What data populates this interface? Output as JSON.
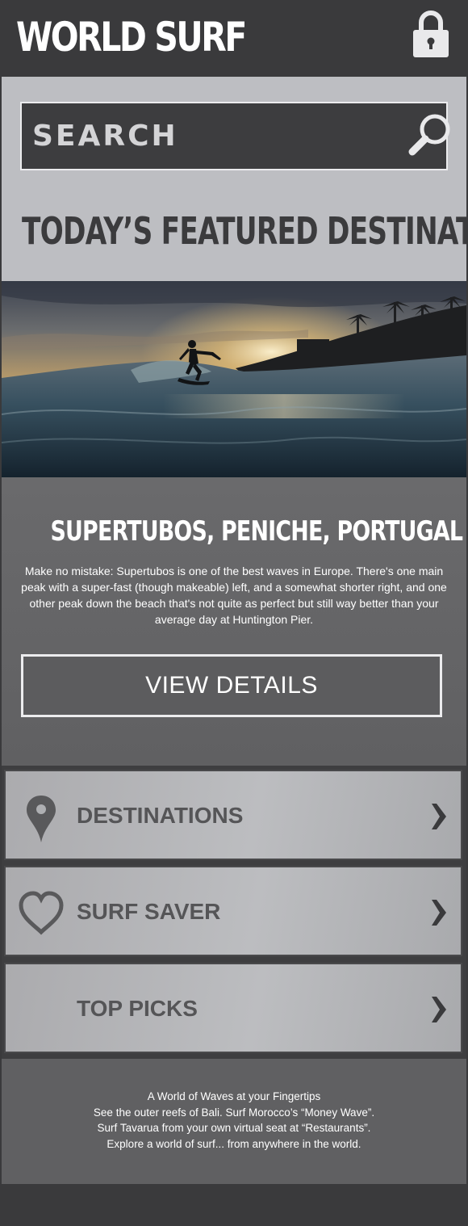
{
  "header": {
    "brand": "WORLD SURF",
    "lock_icon": "padlock-icon"
  },
  "search": {
    "placeholder": "SEARCH",
    "icon": "magnifier-icon"
  },
  "featured": {
    "heading": "TODAY’S FEATURED DESTINATION",
    "image": "surfer-at-sunset-photo"
  },
  "destination": {
    "title": "SUPERTUBOS, PENICHE, PORTUGAL",
    "description": "Make no mistake: Supertubos is one of the best waves in Europe. There's one main peak with a super-fast (though makeable) left, and a somewhat shorter right, and one other peak down the beach that's not quite as perfect but still way better than your average day at Huntington Pier.",
    "button_label": "VIEW DETAILS"
  },
  "menu": {
    "items": [
      {
        "label": "DESTINATIONS",
        "icon": "map-pin-icon"
      },
      {
        "label": "SURF SAVER",
        "icon": "heart-icon"
      },
      {
        "label": "TOP PICKS",
        "icon": ""
      }
    ],
    "chevron": "❯"
  },
  "footer": {
    "lines": [
      "A World of Waves at your Fingertips",
      "See the outer reefs of Bali. Surf Morocco’s “Money Wave”.",
      "Surf Tavarua from your own virtual seat at “Restaurants”.",
      "Explore a world of surf... from anywhere in the world."
    ]
  },
  "colors": {
    "header_bg": "#3a3a3c",
    "page_bg": "#bdbec2",
    "panel_bg": "#646466",
    "text_dark": "#3b3b3d",
    "text_light": "#ffffff"
  }
}
